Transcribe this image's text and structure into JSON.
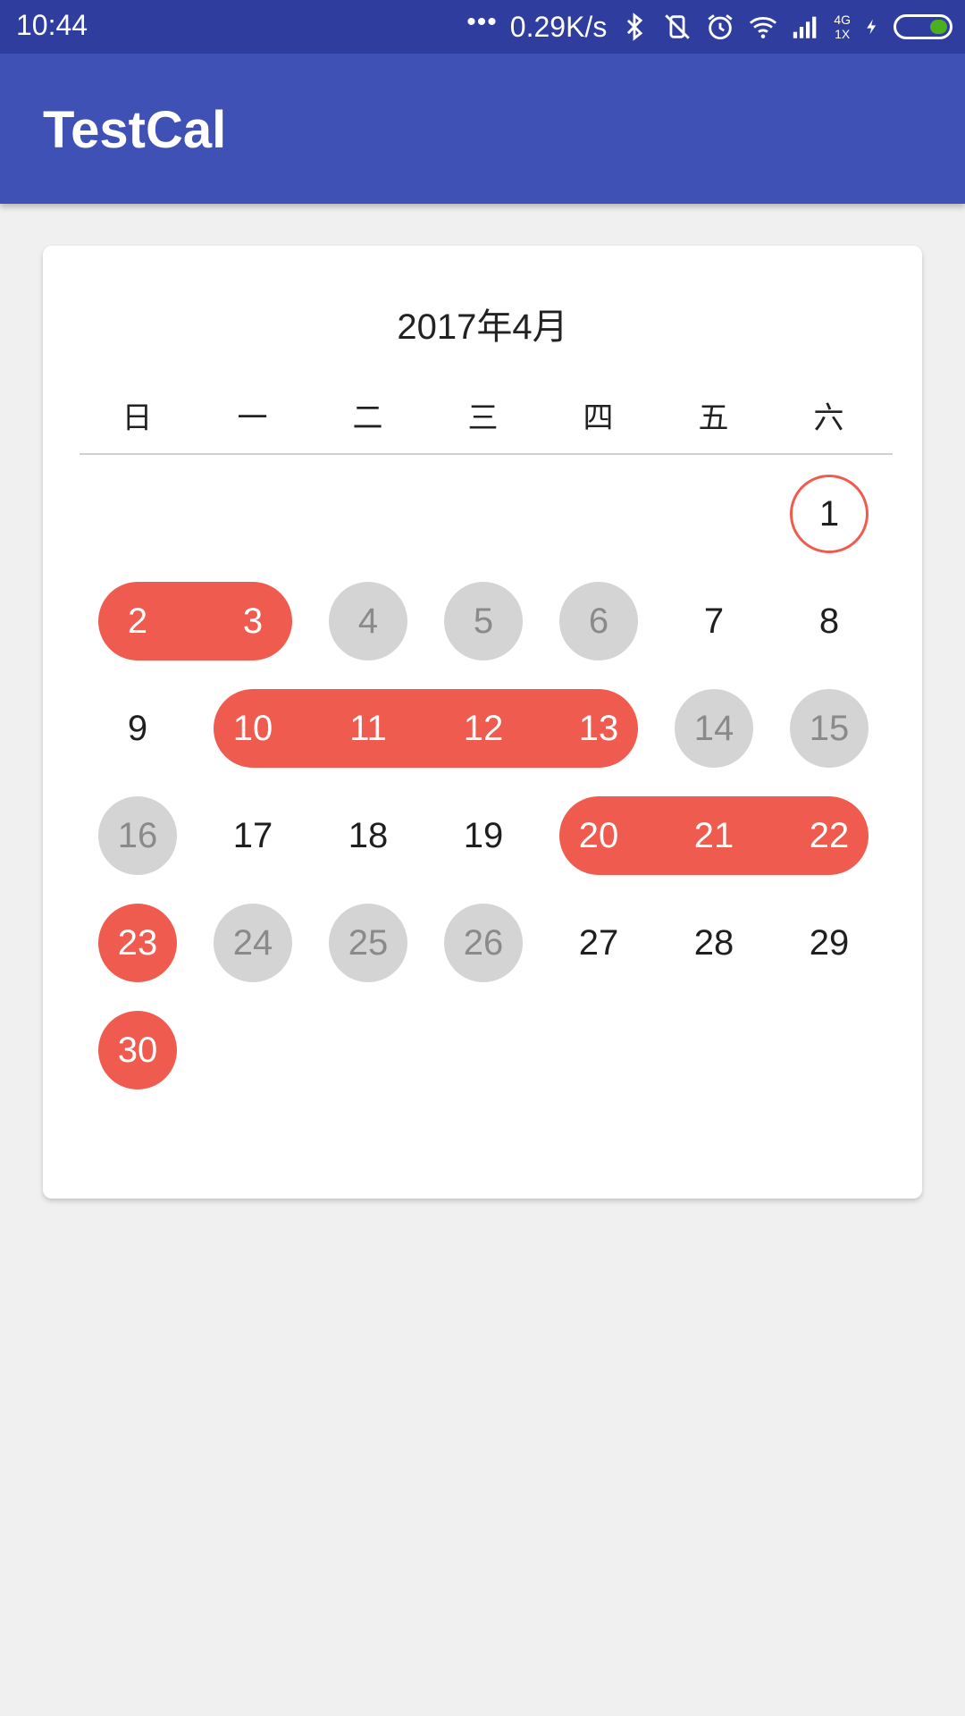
{
  "status_bar": {
    "time": "10:44",
    "more": "•••",
    "net_speed": "0.29K/s",
    "network_label": "4G",
    "network_sub": "1X",
    "icons": [
      "bluetooth-icon",
      "vibrate-off-icon",
      "alarm-icon",
      "wifi-icon",
      "signal-icon",
      "charging-icon",
      "battery-icon"
    ],
    "battery_level": 0.35
  },
  "app_bar": {
    "title": "TestCal"
  },
  "calendar": {
    "month_title": "2017年4月",
    "weekdays": [
      "日",
      "一",
      "二",
      "三",
      "四",
      "五",
      "六"
    ],
    "first_weekday_index": 6,
    "days_in_month": 30,
    "today": 1,
    "selected_ranges": [
      [
        2,
        3
      ],
      [
        10,
        13
      ],
      [
        20,
        22
      ],
      [
        23,
        23
      ],
      [
        30,
        30
      ]
    ],
    "disabled_days": [
      4,
      5,
      6,
      14,
      15,
      16,
      24,
      25,
      26
    ],
    "colors": {
      "accent": "#ef5b4f",
      "disabled_bg": "#d4d4d4",
      "disabled_text": "#8a8a8a",
      "normal_text": "#1f1f1f",
      "selected_text": "#ffffff",
      "primary": "#3f51b5",
      "primary_dark": "#2f3e9e"
    }
  }
}
